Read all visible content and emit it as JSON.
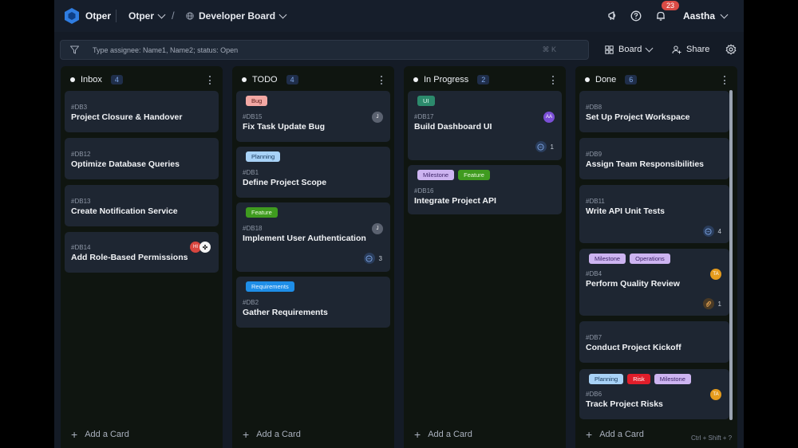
{
  "header": {
    "brand": "Otper",
    "workspace": "Otper",
    "separator": "/",
    "board_name": "Developer Board",
    "notification_count": "23",
    "user_name": "Aastha"
  },
  "toolbar": {
    "filter_placeholder": "Type assignee: Name1, Name2; status: Open",
    "filter_shortcut": "⌘ K",
    "view_label": "Board",
    "share_label": "Share"
  },
  "columns": [
    {
      "name": "Inbox",
      "count": "4",
      "add_label": "Add a Card",
      "cards": [
        {
          "id": "#DB3",
          "title": "Project Closure & Handover"
        },
        {
          "id": "#DB12",
          "title": "Optimize Database Queries"
        },
        {
          "id": "#DB13",
          "title": "Create Notification Service"
        },
        {
          "id": "#DB14",
          "title": "Add Role-Based Permissions",
          "avatars": [
            "HI",
            "✤"
          ]
        }
      ]
    },
    {
      "name": "TODO",
      "count": "4",
      "add_label": "Add a Card",
      "cards": [
        {
          "id": "#DB15",
          "title": "Fix Task Update Bug",
          "tags": [
            "Bug"
          ],
          "avatar": "J"
        },
        {
          "id": "#DB1",
          "title": "Define Project Scope",
          "tags": [
            "Planning"
          ]
        },
        {
          "id": "#DB18",
          "title": "Implement User Authentication",
          "tags": [
            "Feature"
          ],
          "avatar": "J",
          "comments": "3"
        },
        {
          "id": "#DB2",
          "title": "Gather Requirements",
          "tags": [
            "Requirements"
          ]
        }
      ]
    },
    {
      "name": "In Progress",
      "count": "2",
      "add_label": "Add a Card",
      "cards": [
        {
          "id": "#DB17",
          "title": "Build Dashboard UI",
          "tags": [
            "UI"
          ],
          "avatar": "AA",
          "comments": "1"
        },
        {
          "id": "#DB16",
          "title": "Integrate Project API",
          "tags": [
            "Milestone",
            "Feature"
          ]
        }
      ]
    },
    {
      "name": "Done",
      "count": "6",
      "add_label": "Add a Card",
      "cards": [
        {
          "id": "#DB8",
          "title": "Set Up Project Workspace"
        },
        {
          "id": "#DB9",
          "title": "Assign Team Responsibilities"
        },
        {
          "id": "#DB11",
          "title": "Write API Unit Tests",
          "comments": "4"
        },
        {
          "id": "#DB4",
          "title": "Perform Quality Review",
          "tags": [
            "Milestone",
            "Operations"
          ],
          "avatar": "TA",
          "attachments": "1"
        },
        {
          "id": "#DB7",
          "title": "Conduct Project Kickoff"
        },
        {
          "id": "#DB6",
          "title": "Track Project Risks",
          "tags": [
            "Planning",
            "Risk",
            "Milestone"
          ],
          "avatar": "TA"
        }
      ]
    }
  ],
  "shortcut_hint": "Ctrl + Shift + ?",
  "colors": {
    "accent": "#1e8ee8",
    "background": "#141b26",
    "card": "#1e2632"
  }
}
